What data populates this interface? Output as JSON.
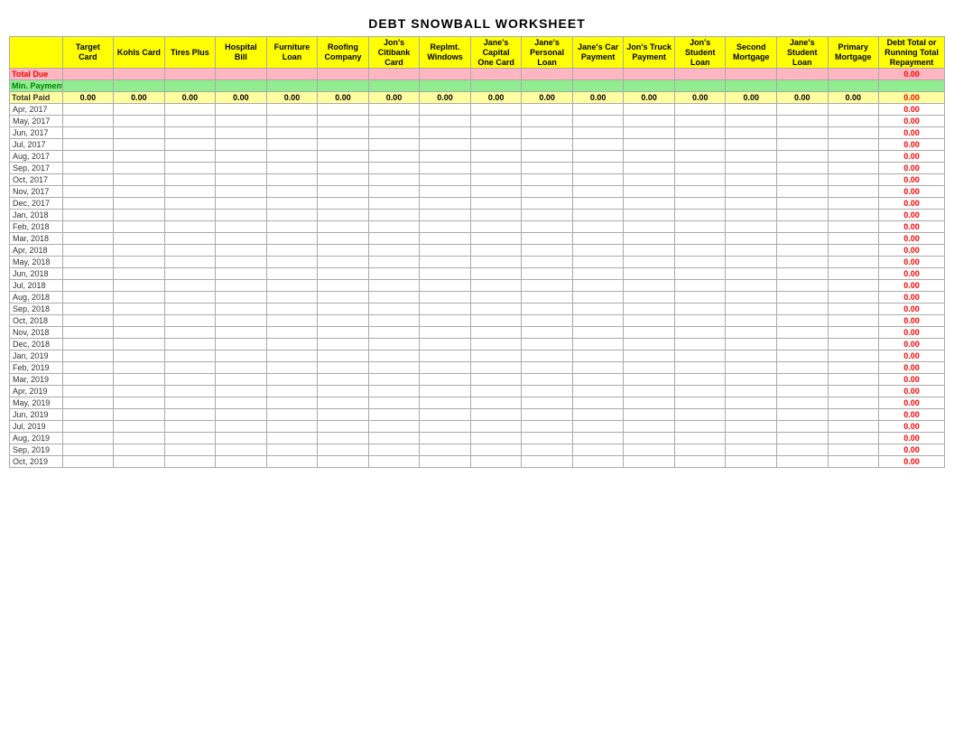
{
  "title": "DEBT SNOWBALL WORKSHEET",
  "columns": [
    {
      "id": "date",
      "label": ""
    },
    {
      "id": "target_card",
      "label": "Target\nCard"
    },
    {
      "id": "kohls_card",
      "label": "Kohls Card"
    },
    {
      "id": "tires_plus",
      "label": "Tires Plus"
    },
    {
      "id": "hospital_bill",
      "label": "Hospital\nBill"
    },
    {
      "id": "furniture_loan",
      "label": "Furniture\nLoan"
    },
    {
      "id": "roofing_company",
      "label": "Roofing\nCompany"
    },
    {
      "id": "jons_citibank",
      "label": "Jon's\nCitibank\nCard"
    },
    {
      "id": "replmt_windows",
      "label": "Replmt.\nWindows"
    },
    {
      "id": "janes_capital_one",
      "label": "Jane's\nCapital\nOne Card"
    },
    {
      "id": "janes_personal_loan",
      "label": "Jane's\nPersonal\nLoan"
    },
    {
      "id": "janes_car_payment",
      "label": "Jane's Car\nPayment"
    },
    {
      "id": "jons_truck_payment",
      "label": "Jon's Truck\nPayment"
    },
    {
      "id": "jons_student_loan",
      "label": "Jon's\nStudent\nLoan"
    },
    {
      "id": "second_mortgage",
      "label": "Second\nMortgage"
    },
    {
      "id": "janes_student_loan",
      "label": "Jane's\nStudent\nLoan"
    },
    {
      "id": "primary_mortgage",
      "label": "Primary\nMortgage"
    },
    {
      "id": "debt_total",
      "label": "Debt Total or\nRunning Total\nRepayment"
    }
  ],
  "rows": {
    "total_due_label": "Total Due",
    "min_payment_label": "Min. Payment",
    "total_paid_label": "Total Paid",
    "total_paid_values": [
      "0.00",
      "0.00",
      "0.00",
      "0.00",
      "0.00",
      "0.00",
      "0.00",
      "0.00",
      "0.00",
      "0.00",
      "0.00",
      "0.00",
      "0.00",
      "0.00",
      "0.00",
      "0.00",
      "0.00"
    ],
    "date_rows": [
      "Apr, 2017",
      "May, 2017",
      "Jun, 2017",
      "Jul, 2017",
      "Aug, 2017",
      "Sep, 2017",
      "Oct, 2017",
      "Nov, 2017",
      "Dec, 2017",
      "Jan, 2018",
      "Feb, 2018",
      "Mar, 2018",
      "Apr, 2018",
      "May, 2018",
      "Jun, 2018",
      "Jul, 2018",
      "Aug, 2018",
      "Sep, 2018",
      "Oct, 2018",
      "Nov, 2018",
      "Dec, 2018",
      "Jan, 2019",
      "Feb, 2019",
      "Mar, 2019",
      "Apr, 2019",
      "May, 2019",
      "Jun, 2019",
      "Jul, 2019",
      "Aug, 2019",
      "Sep, 2019",
      "Oct, 2019"
    ],
    "row_last_value": "0.00"
  }
}
